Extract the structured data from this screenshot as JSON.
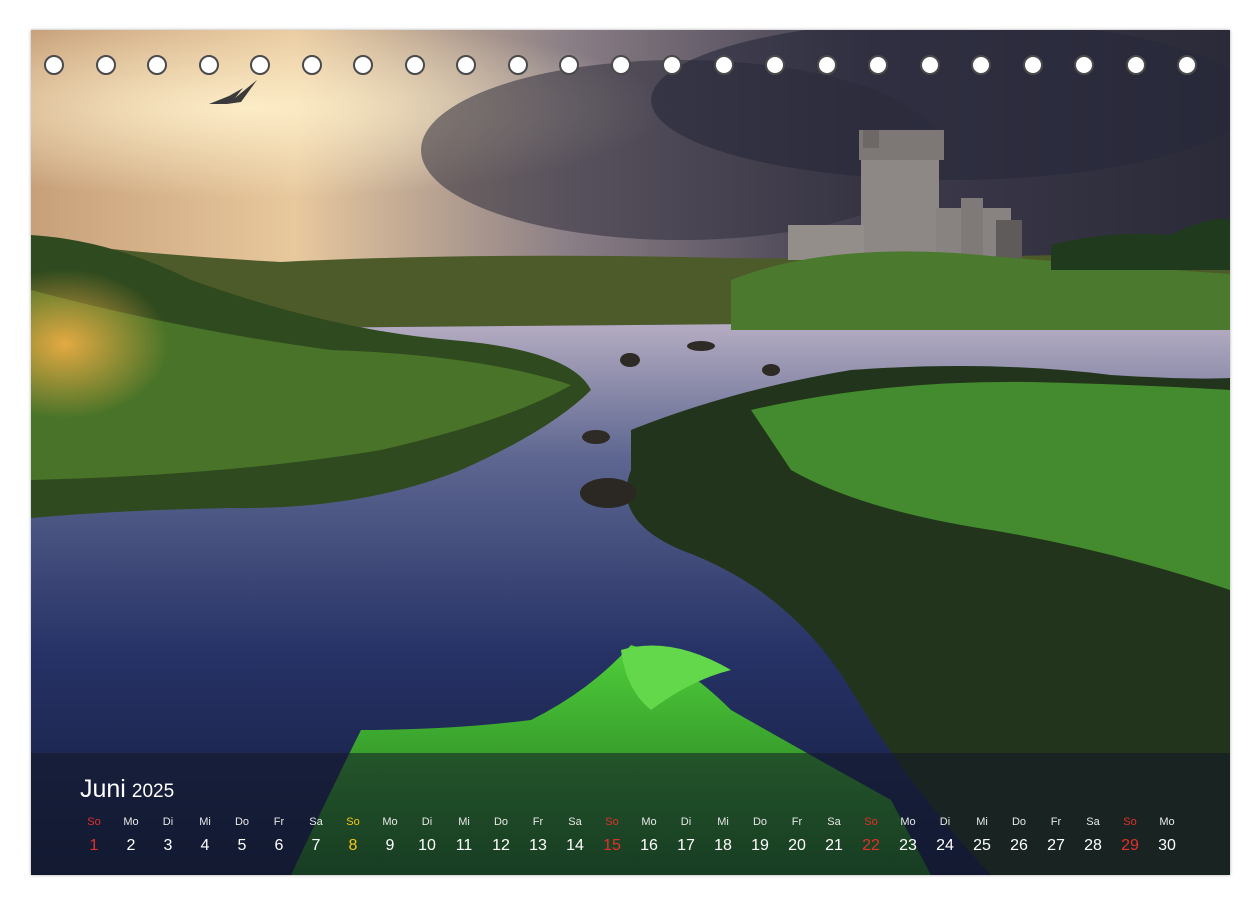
{
  "calendar": {
    "month": "Juni",
    "year": "2025",
    "weekdays": [
      "So",
      "Mo",
      "Di",
      "Mi",
      "Do",
      "Fr",
      "Sa",
      "So",
      "Mo",
      "Di",
      "Mi",
      "Do",
      "Fr",
      "Sa",
      "So",
      "Mo",
      "Di",
      "Mi",
      "Do",
      "Fr",
      "Sa",
      "So",
      "Mo",
      "Di",
      "Mi",
      "Do",
      "Fr",
      "Sa",
      "So",
      "Mo"
    ],
    "days": [
      "1",
      "2",
      "3",
      "4",
      "5",
      "6",
      "7",
      "8",
      "9",
      "10",
      "11",
      "12",
      "13",
      "14",
      "15",
      "16",
      "17",
      "18",
      "19",
      "20",
      "21",
      "22",
      "23",
      "24",
      "25",
      "26",
      "27",
      "28",
      "29",
      "30"
    ],
    "highlight_days": {
      "8": "holiday"
    }
  },
  "colors": {
    "sunday": "#e2312a",
    "holiday": "#f5c518",
    "text": "#ffffff"
  },
  "binding_holes": 23
}
